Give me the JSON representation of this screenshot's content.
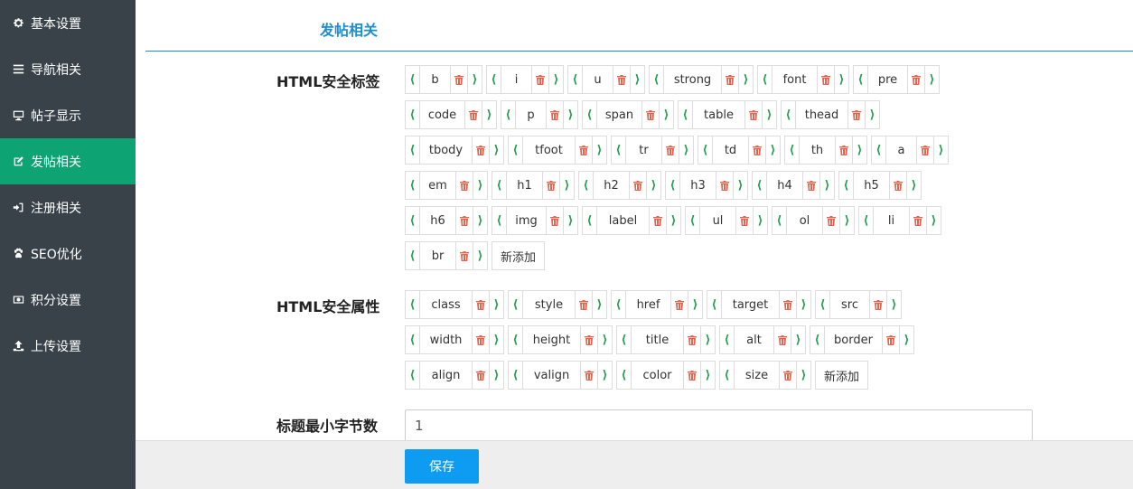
{
  "sidebar": {
    "items": [
      {
        "label": "基本设置",
        "icon": "gear-icon"
      },
      {
        "label": "导航相关",
        "icon": "bars-icon"
      },
      {
        "label": "帖子显示",
        "icon": "monitor-icon"
      },
      {
        "label": "发帖相关",
        "icon": "edit-icon",
        "active": true
      },
      {
        "label": "注册相关",
        "icon": "sign-in-icon"
      },
      {
        "label": "SEO优化",
        "icon": "paw-icon"
      },
      {
        "label": "积分设置",
        "icon": "money-icon"
      },
      {
        "label": "上传设置",
        "icon": "upload-icon"
      }
    ]
  },
  "section": {
    "title": "发帖相关"
  },
  "html_tags": {
    "label": "HTML安全标签",
    "rows": [
      [
        "b",
        "i",
        "u",
        "strong",
        "font",
        "pre"
      ],
      [
        "code",
        "p",
        "span",
        "table",
        "thead"
      ],
      [
        "tbody",
        "tfoot",
        "tr",
        "td",
        "th",
        "a"
      ],
      [
        "em",
        "h1",
        "h2",
        "h3",
        "h4",
        "h5"
      ],
      [
        "h6",
        "img",
        "label",
        "ul",
        "ol",
        "li"
      ],
      [
        "br"
      ]
    ],
    "add_label": "新添加"
  },
  "html_attrs": {
    "label": "HTML安全属性",
    "rows": [
      [
        "class",
        "style",
        "href",
        "target",
        "src"
      ],
      [
        "width",
        "height",
        "title",
        "alt",
        "border"
      ],
      [
        "align",
        "valign",
        "color",
        "size"
      ]
    ],
    "add_label": "新添加"
  },
  "title_min": {
    "label": "标题最小字节数",
    "value": "1"
  },
  "footer": {
    "save_label": "保存"
  },
  "colors": {
    "accent": "#1e8ecb",
    "active": "#0ea373",
    "sidebar": "#394249",
    "arrow": "#1fa04a",
    "delete": "#e8634e",
    "save": "#0d9cf2"
  }
}
